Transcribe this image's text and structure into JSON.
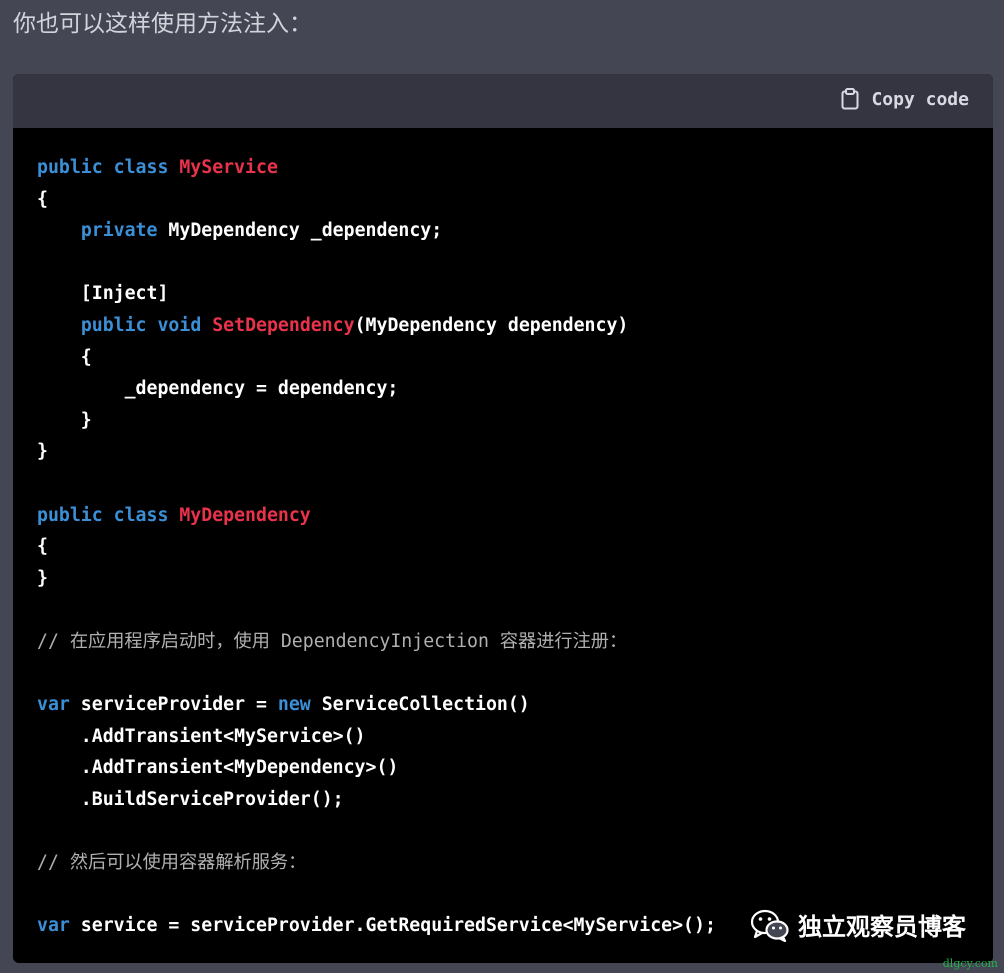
{
  "message": {
    "intro_text": "你也可以这样使用方法注入："
  },
  "code_block": {
    "copy_label": "Copy code",
    "copy_icon": "clipboard-icon",
    "colors": {
      "keyword": "#3b8fd6",
      "type_name": "#e9334b",
      "plain": "#ffffff",
      "comment": "#b0b0b0",
      "header_bg": "#343541",
      "code_bg": "#000000"
    },
    "lines": [
      {
        "tokens": [
          {
            "t": "kw",
            "v": "public"
          },
          {
            "t": "p",
            "v": " "
          },
          {
            "t": "kw",
            "v": "class"
          },
          {
            "t": "p",
            "v": " "
          },
          {
            "t": "fn",
            "v": "MyService"
          }
        ]
      },
      {
        "tokens": [
          {
            "t": "p",
            "v": "{"
          }
        ]
      },
      {
        "tokens": [
          {
            "t": "p",
            "v": "    "
          },
          {
            "t": "kw",
            "v": "private"
          },
          {
            "t": "p",
            "v": " MyDependency _dependency;"
          }
        ]
      },
      {
        "tokens": []
      },
      {
        "tokens": [
          {
            "t": "p",
            "v": "    [Inject]"
          }
        ]
      },
      {
        "tokens": [
          {
            "t": "p",
            "v": "    "
          },
          {
            "t": "kw",
            "v": "public"
          },
          {
            "t": "p",
            "v": " "
          },
          {
            "t": "kw",
            "v": "void"
          },
          {
            "t": "p",
            "v": " "
          },
          {
            "t": "fn",
            "v": "SetDependency"
          },
          {
            "t": "p",
            "v": "(MyDependency dependency)"
          }
        ]
      },
      {
        "tokens": [
          {
            "t": "p",
            "v": "    {"
          }
        ]
      },
      {
        "tokens": [
          {
            "t": "p",
            "v": "        _dependency = dependency;"
          }
        ]
      },
      {
        "tokens": [
          {
            "t": "p",
            "v": "    }"
          }
        ]
      },
      {
        "tokens": [
          {
            "t": "p",
            "v": "}"
          }
        ]
      },
      {
        "tokens": []
      },
      {
        "tokens": [
          {
            "t": "kw",
            "v": "public"
          },
          {
            "t": "p",
            "v": " "
          },
          {
            "t": "kw",
            "v": "class"
          },
          {
            "t": "p",
            "v": " "
          },
          {
            "t": "fn",
            "v": "MyDependency"
          }
        ]
      },
      {
        "tokens": [
          {
            "t": "p",
            "v": "{"
          }
        ]
      },
      {
        "tokens": [
          {
            "t": "p",
            "v": "}"
          }
        ]
      },
      {
        "tokens": []
      },
      {
        "tokens": [
          {
            "t": "cm",
            "v": "// 在应用程序启动时，使用 DependencyInjection 容器进行注册："
          }
        ]
      },
      {
        "tokens": []
      },
      {
        "tokens": [
          {
            "t": "kw",
            "v": "var"
          },
          {
            "t": "p",
            "v": " serviceProvider = "
          },
          {
            "t": "kw",
            "v": "new"
          },
          {
            "t": "p",
            "v": " ServiceCollection()"
          }
        ]
      },
      {
        "tokens": [
          {
            "t": "p",
            "v": "    .AddTransient<MyService>()"
          }
        ]
      },
      {
        "tokens": [
          {
            "t": "p",
            "v": "    .AddTransient<MyDependency>()"
          }
        ]
      },
      {
        "tokens": [
          {
            "t": "p",
            "v": "    .BuildServiceProvider();"
          }
        ]
      },
      {
        "tokens": []
      },
      {
        "tokens": [
          {
            "t": "cm",
            "v": "// 然后可以使用容器解析服务："
          }
        ]
      },
      {
        "tokens": []
      },
      {
        "tokens": [
          {
            "t": "kw",
            "v": "var"
          },
          {
            "t": "p",
            "v": " service = serviceProvider.GetRequiredService<MyService>();"
          }
        ]
      }
    ]
  },
  "watermark": {
    "icon": "wechat-icon",
    "text": "独立观察员博客",
    "site": "dlgcy.com"
  }
}
